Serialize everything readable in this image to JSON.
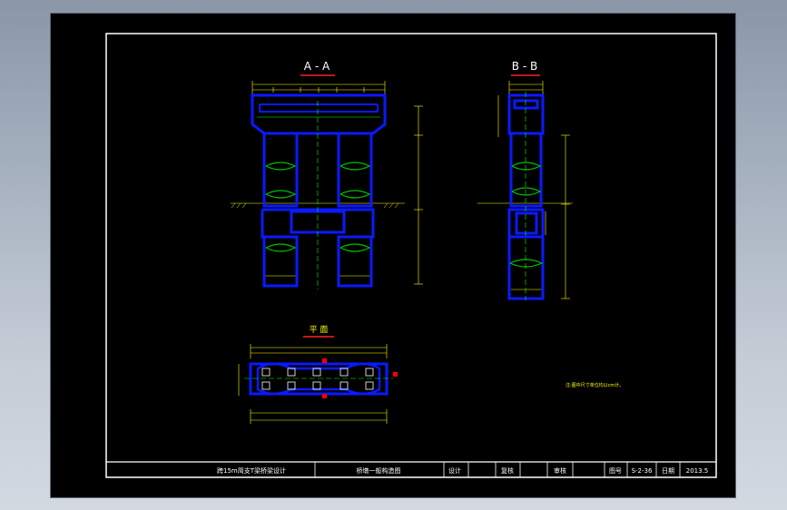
{
  "views": {
    "aa": {
      "title": "A - A"
    },
    "bb": {
      "title": "B - B"
    },
    "plan": {
      "title": "平   面"
    }
  },
  "note": "注:图中尺寸单位均以cm计。",
  "title_block": {
    "project": "跨15m简支T梁桥梁设计",
    "drawing_name": "桥墩一般构造图",
    "design_label": "设计",
    "review_label": "复核",
    "approve_label": "审核",
    "drawing_no_label": "图号",
    "drawing_no": "S-2-36",
    "date_label": "日期",
    "date": "2013.5"
  },
  "colors": {
    "structure": "#0a1aff",
    "dimension": "#ffff00",
    "green": "#00ff00",
    "red": "#ff0000",
    "frame": "#ffffff",
    "background": "#000000"
  }
}
